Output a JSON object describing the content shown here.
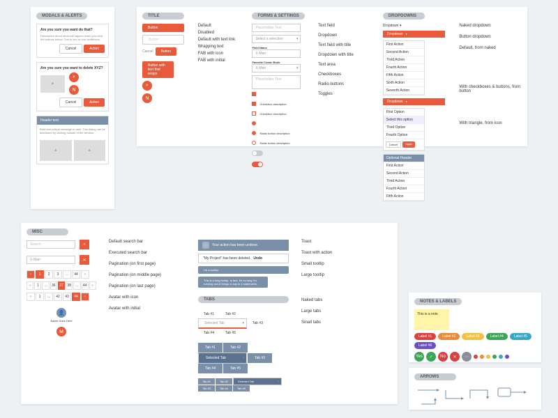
{
  "modals": {
    "title": "MODALS & ALERTS",
    "m1": {
      "title": "Are you sure you want do that?",
      "body": "Description about what will happen when you click the buttons below. One to two or four sentences.",
      "cancel": "Cancel",
      "action": "Action"
    },
    "m2": {
      "title": "Are you sure you want to delete XYZ?",
      "cancel": "Cancel",
      "action": "Action"
    },
    "m3": {
      "title": "Header text",
      "body": "Brief non-critical message to user. This dialog can be dismissed by clicking outside of the window."
    }
  },
  "buttons": {
    "title": "TITLE",
    "items": [
      "Default",
      "Disabled",
      "Default with text link",
      "Wrapping text",
      "FAB with icon",
      "FAB with initial"
    ],
    "primary": "Button",
    "secondary": "Button",
    "wrap": "Button with text that wraps",
    "fab_init": "N"
  },
  "forms": {
    "title": "FORMS & SETTINGS",
    "labels": [
      "Text field",
      "Dropdown",
      "Text field with title",
      "Dropdown with title",
      "Text area",
      "Checkboxes",
      "Radio buttons",
      "Toggles"
    ],
    "ph": "Placeholder Text",
    "sel": "Select a selection",
    "val": "X-Man",
    "field_name": "Field Name",
    "fav": "Favorite Comic Book",
    "cb": "Checkbox description",
    "rb": "Radio button description"
  },
  "dropdowns": {
    "title": "DROPDOWNS",
    "labels": [
      "Naked dropdown",
      "Button dropdown",
      "Default, from naked",
      "With checkboxes & buttons, from button",
      "With triangle, from icon"
    ],
    "naked": "Dropdown",
    "btn": "Dropdown",
    "actions": [
      "First Action",
      "Second Action",
      "Third Action",
      "Fourth Action",
      "Fifth Action",
      "Sixth Action",
      "Seventh Action"
    ],
    "opts": [
      "First Option",
      "Select this option",
      "Third Option",
      "Fourth Option"
    ],
    "cancel": "Cancel",
    "apply": "Apply",
    "opthdr": "Optional Header"
  },
  "misc": {
    "title": "MISC",
    "labels": [
      "Default search bar",
      "Executed search bar",
      "Pagination (on first page)",
      "Pagination (on middle page)",
      "Pagination (on last page)",
      "Avatar with icon",
      "Avatar with initial"
    ],
    "search_ph": "Search",
    "search_val": "X-Man",
    "toast1": "Your action has been undone.",
    "toast2": "\"My Project\" has been deleted.",
    "undo": "Undo",
    "tooltip_s": "I'm a tooltip!",
    "tooltip_l": "This is a long tooltip. In fact, it's so long I'm running out of things to say in 4 statements.",
    "toast_labels": [
      "Toast",
      "Toast with action",
      "Small tooltip",
      "Large tooltip"
    ],
    "avatar_name": "Name Goes Here",
    "avatar_init": "M"
  },
  "tabs": {
    "title": "TABS",
    "items": [
      "Tab #1",
      "Tab #2",
      "Selected Tab",
      "Tab #3",
      "Tab #4",
      "Tab #5"
    ],
    "labels": [
      "Naked tabs",
      "Large tabs",
      "Small tabs"
    ]
  },
  "notes": {
    "title": "NOTES & LABELS",
    "note": "This is a note",
    "pill_labels": [
      "Label #1",
      "Label #2",
      "Label #3",
      "Label #4",
      "Label #5",
      "Label #6"
    ],
    "yes": "Yes",
    "no": "No"
  },
  "arrows": {
    "title": "ARROWS"
  },
  "colors": {
    "orange": "#e85a3a",
    "blue": "#7a8fa8",
    "green": "#3aa655",
    "yellow": "#f0c040",
    "red": "#d94040",
    "cyan": "#3aa6c4",
    "purple": "#6a4fc4",
    "gray": "#8a8f96"
  }
}
